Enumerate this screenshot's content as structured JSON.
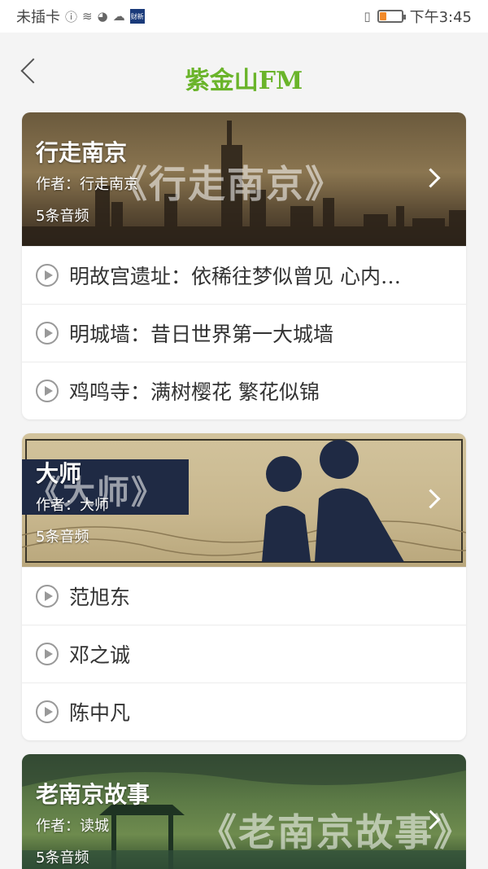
{
  "status": {
    "carrier": "未插卡",
    "time": "下午3:45",
    "news_badge": "财新"
  },
  "nav": {
    "title": "紫金山FM"
  },
  "cards": [
    {
      "banner_text": "《行走南京》",
      "title": "行走南京",
      "author": "作者：行走南京",
      "count": "5条音频",
      "items": [
        {
          "label": "明故宫遗址：依稀往梦似曾见  心内…"
        },
        {
          "label": "明城墙：昔日世界第一大城墙"
        },
        {
          "label": "鸡鸣寺：满树樱花  繁花似锦"
        }
      ]
    },
    {
      "banner_text": "《大师》",
      "title": "大师",
      "author": "作者：大师",
      "count": "5条音频",
      "items": [
        {
          "label": "范旭东"
        },
        {
          "label": "邓之诚"
        },
        {
          "label": "陈中凡"
        }
      ]
    },
    {
      "banner_text": "《老南京故事》",
      "title": "老南京故事",
      "author": "作者：读城",
      "count": "5条音频",
      "items": []
    }
  ]
}
